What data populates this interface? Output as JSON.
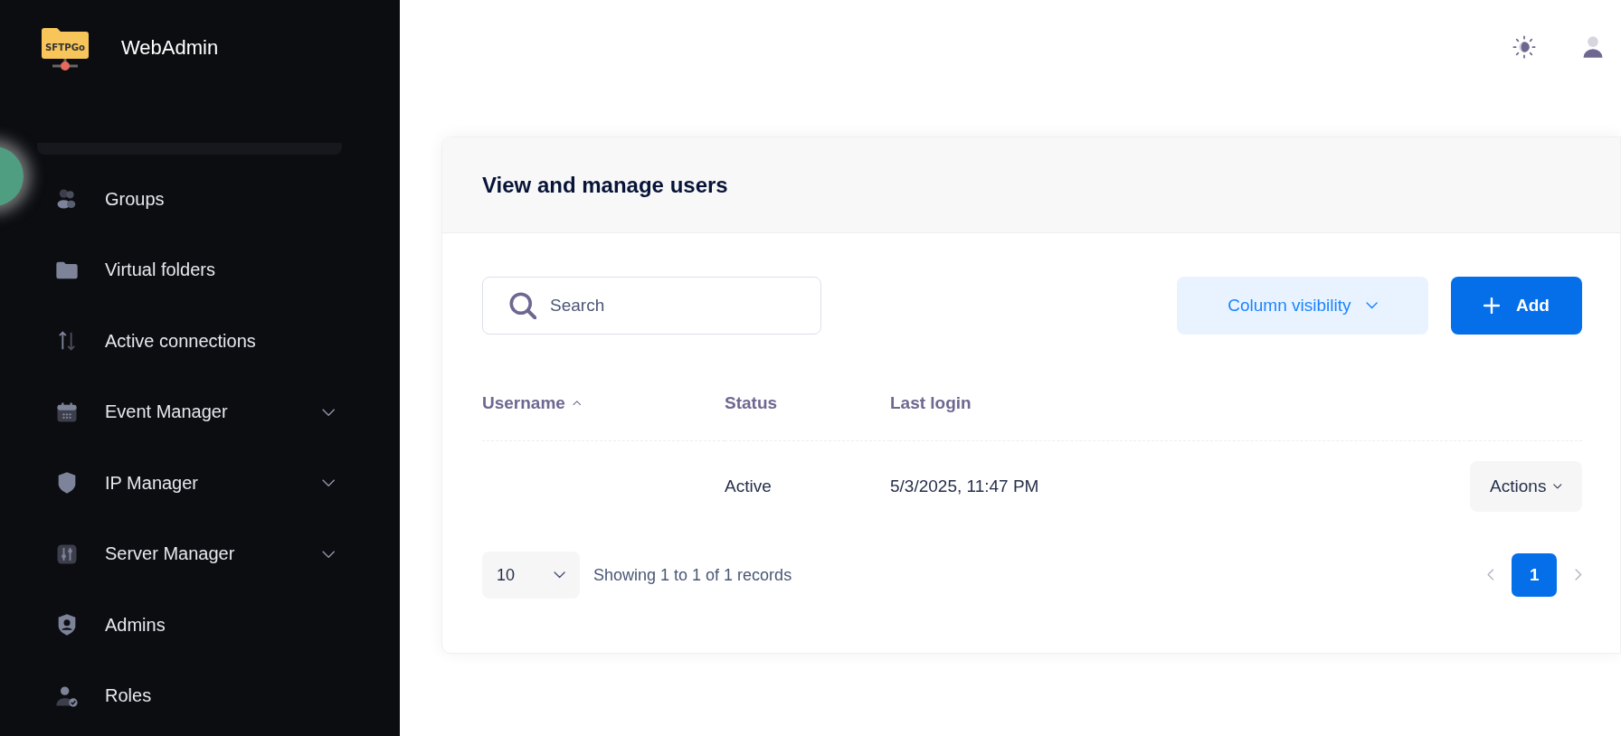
{
  "sidebar": {
    "brand": {
      "logo_text": "SFTPGo",
      "title": "WebAdmin"
    },
    "items": [
      {
        "label": "Groups",
        "kind": "users",
        "expandable": false
      },
      {
        "label": "Virtual folders",
        "kind": "folder",
        "expandable": false
      },
      {
        "label": "Active connections",
        "kind": "arrows",
        "expandable": false
      },
      {
        "label": "Event Manager",
        "kind": "calendar",
        "expandable": true
      },
      {
        "label": "IP Manager",
        "kind": "shield",
        "expandable": true
      },
      {
        "label": "Server Manager",
        "kind": "sliders",
        "expandable": true
      },
      {
        "label": "Admins",
        "kind": "admin",
        "expandable": false
      },
      {
        "label": "Roles",
        "kind": "role",
        "expandable": false
      }
    ]
  },
  "card": {
    "title": "View and manage users",
    "search": {
      "placeholder": "Search"
    },
    "column_visibility_button": "Column visibility",
    "add_button": "Add",
    "table": {
      "columns": [
        {
          "label": "Username",
          "sorted": true
        },
        {
          "label": "Status",
          "sorted": false
        },
        {
          "label": "Last login",
          "sorted": false
        }
      ],
      "rows": [
        {
          "status": "Active",
          "last_login": "5/3/2025, 11:47 PM",
          "actions": "Actions"
        }
      ]
    },
    "footer": {
      "page_size": "10",
      "summary": "Showing 1 to 1 of 1 records",
      "pages": [
        {
          "label": "1",
          "selected": true
        }
      ]
    }
  }
}
